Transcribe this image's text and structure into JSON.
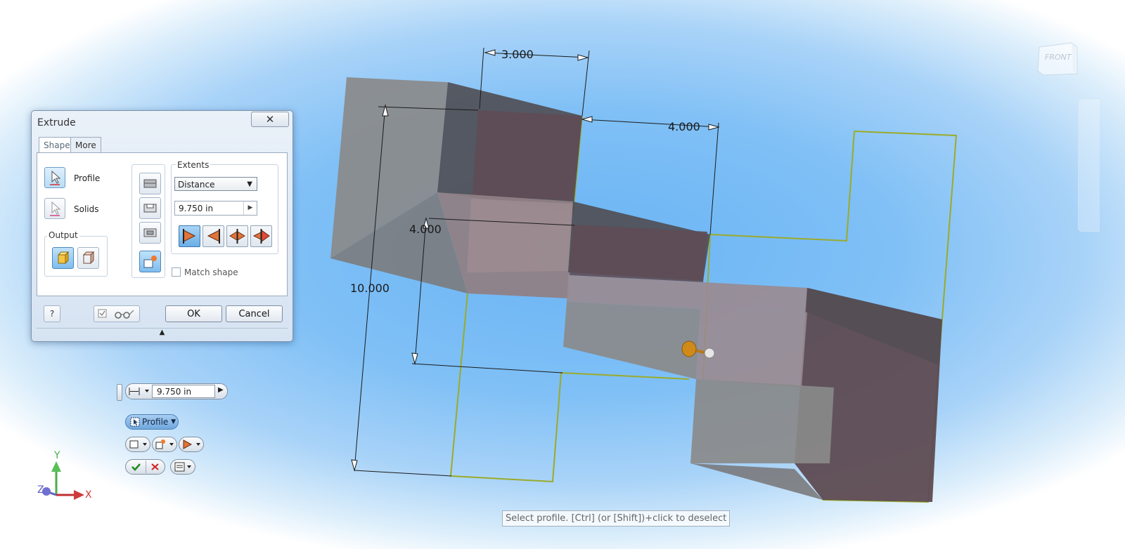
{
  "dialog": {
    "title": "Extrude",
    "close_glyph": "✕",
    "tabs": [
      "Shape",
      "More"
    ],
    "selectors": [
      {
        "label": "Profile",
        "icon": "cursor-arrow-icon"
      },
      {
        "label": "Solids",
        "icon": "cursor-arrow-icon"
      }
    ],
    "output_caption": "Output",
    "extents_caption": "Extents",
    "extents_value": "Distance",
    "distance_value": "9.750 in",
    "match_shape_label": "Match shape",
    "ok_label": "OK",
    "cancel_label": "Cancel",
    "help_glyph": "?",
    "expand_glyph": "▲"
  },
  "mini_toolbar": {
    "distance_value": "9.750 in",
    "profile_label": "Profile"
  },
  "dimensions": {
    "d1": "3.000",
    "d2": "4.000",
    "d3": "4.000",
    "d4": "10.000"
  },
  "status_hint": "Select profile. [Ctrl] (or [Shift])+click to deselect",
  "view_cube_label": "FRONT",
  "axes": {
    "x": "X",
    "y": "Y",
    "z": "Z"
  },
  "colors": {
    "accent_blue": "#6aaee6",
    "profile_outline": "#9aab2a",
    "solid_face": "#5e4b52",
    "translucent_face": "#8c8c8c"
  }
}
